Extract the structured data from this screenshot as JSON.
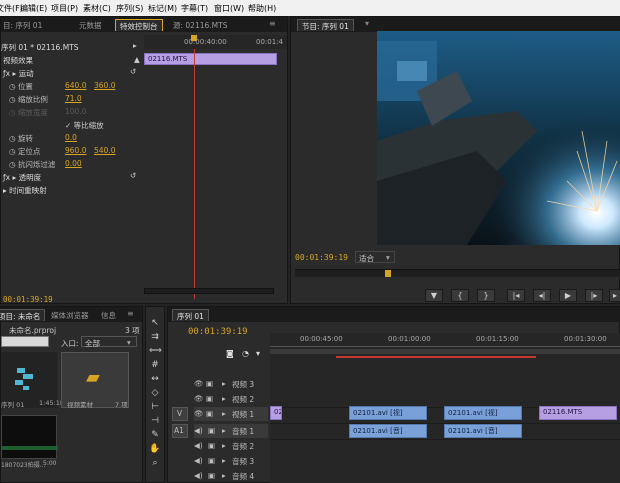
{
  "menu": [
    "文件(F)",
    "编辑(E)",
    "项目(P)",
    "素材(C)",
    "序列(S)",
    "标记(M)",
    "字幕(T)",
    "窗口(W)",
    "帮助(H)"
  ],
  "effect_controls": {
    "tabs": [
      "目: 序列 01",
      "元数据",
      "特效控制台",
      "源: 02116.MTS"
    ],
    "breadcrumb": "序列 01 * 02116.MTS",
    "ruler_labels": [
      "00:00:40:00",
      "00:01:4"
    ],
    "clip_name": "02116.MTS",
    "section": "视频效果",
    "motion": "运动",
    "position_label": "位置",
    "position_x": "640.0",
    "position_y": "360.0",
    "scale_label": "缩放比例",
    "scale_value": "71.0",
    "scale_width_label": "缩放宽度",
    "scale_width_value": "100.0",
    "uniform_scale": "等比缩放",
    "rotation_label": "旋转",
    "rotation_value": "0.0",
    "anchor_label": "定位点",
    "anchor_x": "960.0",
    "anchor_y": "540.0",
    "flicker_label": "抗闪烁过滤",
    "flicker_value": "0.00",
    "opacity": "透明度",
    "time_remap": "时间重映射",
    "timecode": "00:01:39:19"
  },
  "program": {
    "tab": "节目: 序列 01",
    "timecode": "00:01:39:19",
    "fit": "适合"
  },
  "project": {
    "tabs": [
      "项目: 未命名",
      "媒体浏览器",
      "信息"
    ],
    "filename": "未命名.prproj",
    "count": "3 项",
    "in_label": "入口:",
    "in_value": "全部",
    "items": [
      {
        "name": "序列 01",
        "meta": "1:45:18"
      },
      {
        "name": "视频素材",
        "meta": "7 项"
      },
      {
        "name": "1807023拍摄...",
        "meta": "5:00"
      }
    ]
  },
  "timeline": {
    "tab": "序列 01",
    "timecode": "00:01:39:19",
    "ruler": [
      "00:00:45:00",
      "00:01:00:00",
      "00:01:15:00",
      "00:01:30:00"
    ],
    "tracks": [
      {
        "name": "视频 3"
      },
      {
        "name": "视频 2"
      },
      {
        "name": "视频 1"
      },
      {
        "name": "音频 1"
      },
      {
        "name": "音频 2"
      },
      {
        "name": "音频 3"
      },
      {
        "name": "音频 4"
      }
    ],
    "v_label": "V",
    "a_label": "A1",
    "clips_v": [
      "02",
      "02101.avi [视]",
      "02101.avi [视]",
      "02116.MTS"
    ],
    "clips_a": [
      "02101.avi [音]",
      "02101.avi [音]"
    ]
  },
  "colors": {
    "accent": "#d7a521",
    "clip_video": "#79a0d8",
    "clip_purple": "#b79fe4",
    "playhead": "#c53a2e"
  }
}
